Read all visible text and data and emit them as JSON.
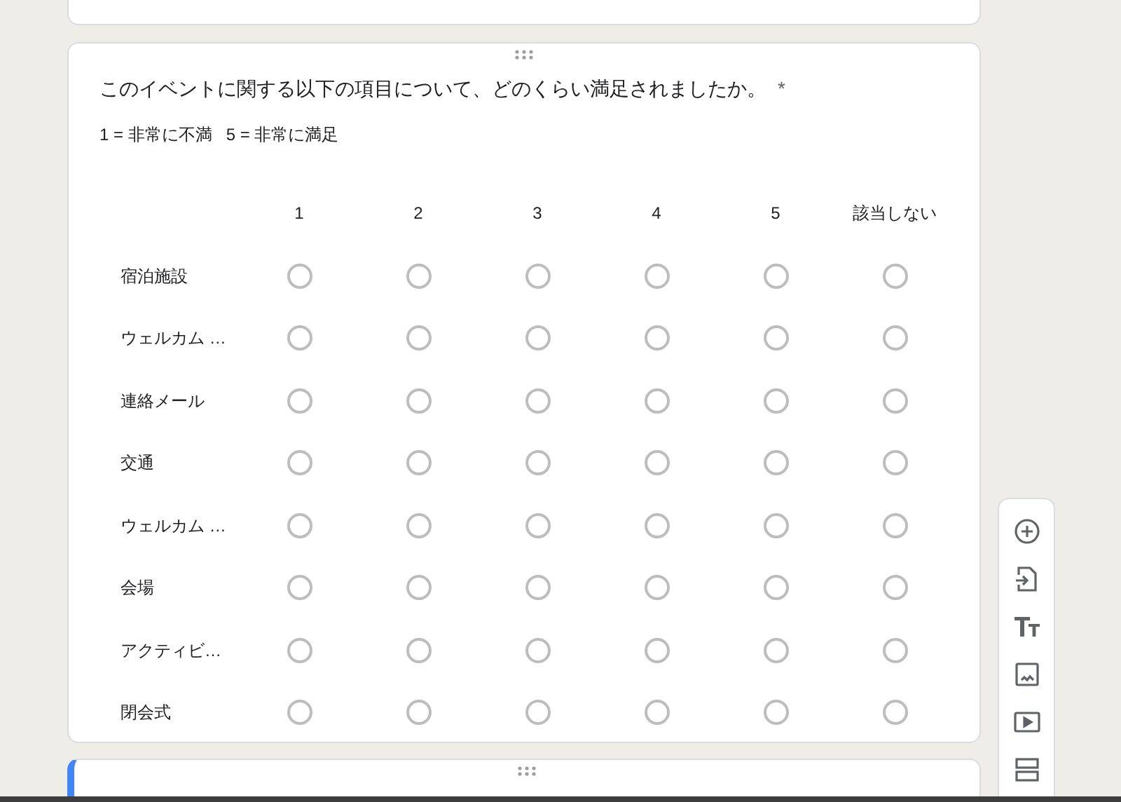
{
  "question": {
    "title": "このイベントに関する以下の項目について、どのくらい満足されましたか。",
    "required_mark": "*",
    "scale_note": "1 = 非常に不満   5 = 非常に満足"
  },
  "columns": [
    "1",
    "2",
    "3",
    "4",
    "5",
    "該当しない"
  ],
  "rows": [
    {
      "label": "宿泊施設",
      "options": [
        {
          "selected": false
        },
        {
          "selected": false
        },
        {
          "selected": false
        },
        {
          "selected": false
        },
        {
          "selected": false
        },
        {
          "selected": false
        }
      ]
    },
    {
      "label": "ウェルカム …",
      "options": [
        {
          "selected": false
        },
        {
          "selected": false
        },
        {
          "selected": false
        },
        {
          "selected": false
        },
        {
          "selected": false
        },
        {
          "selected": false
        }
      ]
    },
    {
      "label": "連絡メール",
      "options": [
        {
          "selected": false
        },
        {
          "selected": false
        },
        {
          "selected": false
        },
        {
          "selected": false
        },
        {
          "selected": false
        },
        {
          "selected": false
        }
      ]
    },
    {
      "label": "交通",
      "options": [
        {
          "selected": false
        },
        {
          "selected": false
        },
        {
          "selected": false
        },
        {
          "selected": false
        },
        {
          "selected": false
        },
        {
          "selected": false
        }
      ]
    },
    {
      "label": "ウェルカム …",
      "options": [
        {
          "selected": false
        },
        {
          "selected": false
        },
        {
          "selected": false
        },
        {
          "selected": false
        },
        {
          "selected": false
        },
        {
          "selected": false
        }
      ]
    },
    {
      "label": "会場",
      "options": [
        {
          "selected": false
        },
        {
          "selected": false
        },
        {
          "selected": false
        },
        {
          "selected": false
        },
        {
          "selected": false
        },
        {
          "selected": false
        }
      ]
    },
    {
      "label": "アクティビ…",
      "options": [
        {
          "selected": false
        },
        {
          "selected": false
        },
        {
          "selected": false
        },
        {
          "selected": false
        },
        {
          "selected": false
        },
        {
          "selected": false
        }
      ]
    },
    {
      "label": "閉会式",
      "options": [
        {
          "selected": false
        },
        {
          "selected": false
        },
        {
          "selected": false
        },
        {
          "selected": false
        },
        {
          "selected": false
        },
        {
          "selected": false
        }
      ]
    }
  ],
  "next_card": {
    "selected": true
  }
}
